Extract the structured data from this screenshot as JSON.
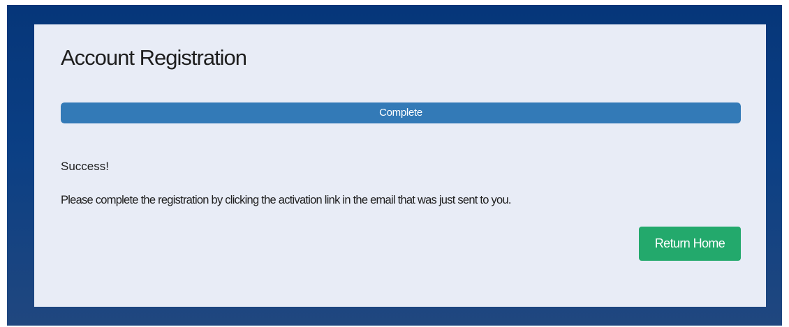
{
  "registration": {
    "title": "Account Registration",
    "progress": {
      "label": "Complete",
      "percent": 100,
      "color": "#337ab7"
    },
    "success_text": "Success!",
    "message": "Please complete the registration by clicking the activation link in the email that was just sent to you.",
    "return_button_label": "Return Home",
    "button_color": "#23a96c"
  }
}
